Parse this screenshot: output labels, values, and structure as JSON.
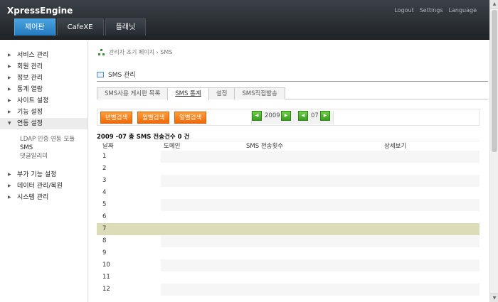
{
  "header": {
    "logo": "XpressEngine",
    "links": [
      "Logout",
      "Settings",
      "Language"
    ],
    "tabs": [
      {
        "label": "제어판",
        "active": true
      },
      {
        "label": "CafeXE",
        "active": false
      },
      {
        "label": "플래닛",
        "active": false
      }
    ]
  },
  "sidebar": {
    "items": [
      {
        "label": "서비스 관리"
      },
      {
        "label": "회원 관리"
      },
      {
        "label": "정보 관리"
      },
      {
        "label": "통계 열람"
      },
      {
        "label": "사이트 설정"
      },
      {
        "label": "기능 설정"
      },
      {
        "label": "연동 설정"
      }
    ],
    "sub_items": [
      {
        "label": "LDAP 인증 연동 모듈"
      },
      {
        "label": "SMS"
      },
      {
        "label": "댓글알리미"
      }
    ],
    "items2": [
      {
        "label": "부가 기능 설정"
      },
      {
        "label": "데이터 관리/복원"
      },
      {
        "label": "시스템 관리"
      }
    ]
  },
  "breadcrumb": "관리자 초기 페이지 › SMS",
  "page_title": "SMS 관리",
  "tabs": [
    {
      "label": "SMS사용 게시판 목록",
      "active": false
    },
    {
      "label": "SMS 통계",
      "active": true
    },
    {
      "label": "설정",
      "active": false
    },
    {
      "label": "SMS직접발송",
      "active": false
    }
  ],
  "filter": {
    "yearly": "년별검색",
    "monthly": "월별검색",
    "daily": "일별검색",
    "year": "2009",
    "month": "07"
  },
  "summary": "2009 -07 총 SMS 전송건수 0 건",
  "table": {
    "headers": [
      "날짜",
      "도메인",
      "SMS 전송횟수",
      "상세보기"
    ],
    "rows": [
      "1",
      "2",
      "3",
      "4",
      "5",
      "6",
      "7",
      "8",
      "9",
      "10",
      "11",
      "12"
    ],
    "highlighted_row": "7"
  },
  "colors": {
    "header_bg": "#262b30",
    "active_tab": "#2d82c6",
    "orange_button": "#f47a10",
    "green_button": "#4cb32a",
    "highlight_row": "#dcdcb8"
  }
}
